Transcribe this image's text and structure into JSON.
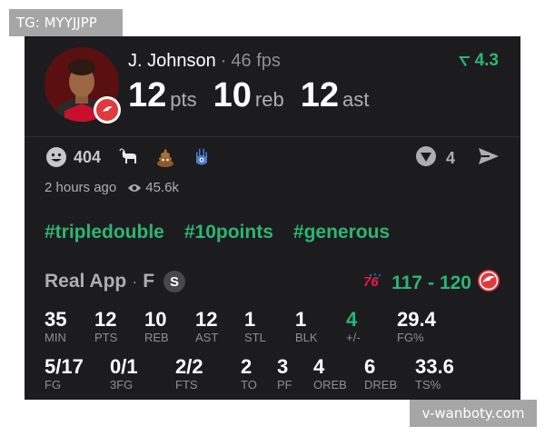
{
  "watermarks": {
    "top_left": "TG: MYYJJPP",
    "bottom_right": "v-wanboty.com"
  },
  "player": {
    "name": "J. Johnson",
    "fps": "46 fps",
    "trend": "4.3",
    "team_badge_icon": "hawks-logo-icon"
  },
  "statline": [
    {
      "value": "12",
      "unit": "pts"
    },
    {
      "value": "10",
      "unit": "reb"
    },
    {
      "value": "12",
      "unit": "ast"
    }
  ],
  "reactions": {
    "count": "404",
    "emojis": [
      "goat-emoji-icon",
      "poop-emoji-icon",
      "hamsa-emoji-icon"
    ],
    "share_count": "4"
  },
  "meta": {
    "time_ago": "2 hours ago",
    "views": "45.6k"
  },
  "tags": [
    "#tripledouble",
    "#10points",
    "#generous"
  ],
  "game": {
    "app": "Real App",
    "position": "F",
    "badge": "S",
    "away_score": "117",
    "home_score": "120",
    "away_team_icon": "76ers-logo-icon",
    "home_team_icon": "hawks-logo-icon"
  },
  "box_score": {
    "row1": [
      {
        "value": "35",
        "label": "MIN",
        "green": false
      },
      {
        "value": "12",
        "label": "PTS",
        "green": false
      },
      {
        "value": "10",
        "label": "REB",
        "green": false
      },
      {
        "value": "12",
        "label": "AST",
        "green": false
      },
      {
        "value": "1",
        "label": "STL",
        "green": false
      },
      {
        "value": "1",
        "label": "BLK",
        "green": false
      },
      {
        "value": "4",
        "label": "+/-",
        "green": true
      },
      {
        "value": "29.4",
        "label": "FG%",
        "green": false
      }
    ],
    "row2": [
      {
        "value": "5/17",
        "label": "FG",
        "green": false
      },
      {
        "value": "0/1",
        "label": "3FG",
        "green": false
      },
      {
        "value": "2/2",
        "label": "FTS",
        "green": false
      },
      {
        "value": "2",
        "label": "TO",
        "green": false
      },
      {
        "value": "3",
        "label": "PF",
        "green": false
      },
      {
        "value": "4",
        "label": "OREB",
        "green": false
      },
      {
        "value": "6",
        "label": "DREB",
        "green": false
      },
      {
        "value": "33.6",
        "label": "TS%",
        "green": false
      }
    ]
  },
  "colors": {
    "accent": "#2bb673",
    "card_bg": "#1c1c1e",
    "hawks_red": "#e03a3e",
    "sixers_blue": "#006bb6"
  }
}
